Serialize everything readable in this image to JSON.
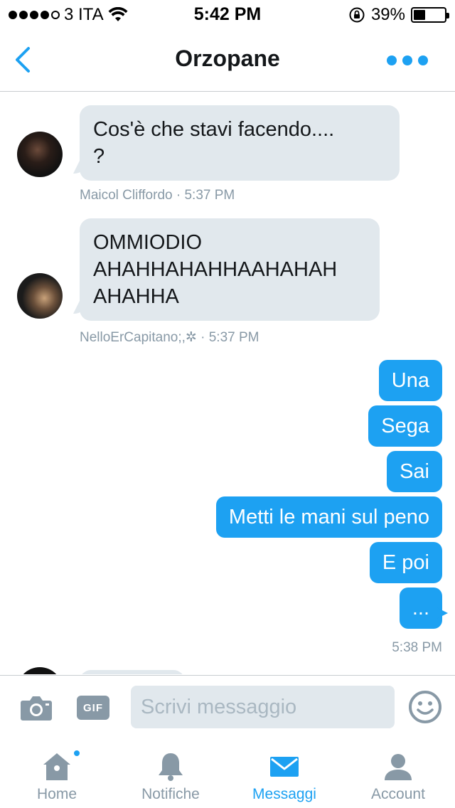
{
  "status_bar": {
    "carrier": "3 ITA",
    "time": "5:42 PM",
    "battery": "39%",
    "battery_level": 0.39
  },
  "header": {
    "title": "Orzopane"
  },
  "messages": [
    {
      "direction": "in",
      "text_lines": [
        "Cos'è che stavi facendo....",
        "?"
      ],
      "sender": "Maicol Cliffordo",
      "time": "5:37 PM"
    },
    {
      "direction": "in",
      "text_lines": [
        "OMMIODIO",
        "AHAHHAHAHHAAHAHAH",
        "AHAHHA"
      ],
      "sender": "NelloErCapitano;,✲",
      "time": "5:37 PM"
    },
    {
      "direction": "out",
      "text": "Una"
    },
    {
      "direction": "out",
      "text": "Sega"
    },
    {
      "direction": "out",
      "text": "Sai"
    },
    {
      "direction": "out",
      "text": "Metti le mani sul peno"
    },
    {
      "direction": "out",
      "text": "E poi"
    },
    {
      "direction": "out",
      "text": "..."
    }
  ],
  "out_time": "5:38 PM",
  "meta_separator": "·",
  "composer": {
    "gif_label": "GIF",
    "placeholder": "Scrivi messaggio"
  },
  "tabs": [
    {
      "label": "Home",
      "icon": "home-icon",
      "active": false
    },
    {
      "label": "Notifiche",
      "icon": "bell-icon",
      "active": false
    },
    {
      "label": "Messaggi",
      "icon": "envelope-icon",
      "active": true
    },
    {
      "label": "Account",
      "icon": "person-icon",
      "active": false
    }
  ],
  "colors": {
    "accent": "#1da1f2",
    "incoming_bubble": "#e1e8ed",
    "muted": "#8899a6"
  }
}
